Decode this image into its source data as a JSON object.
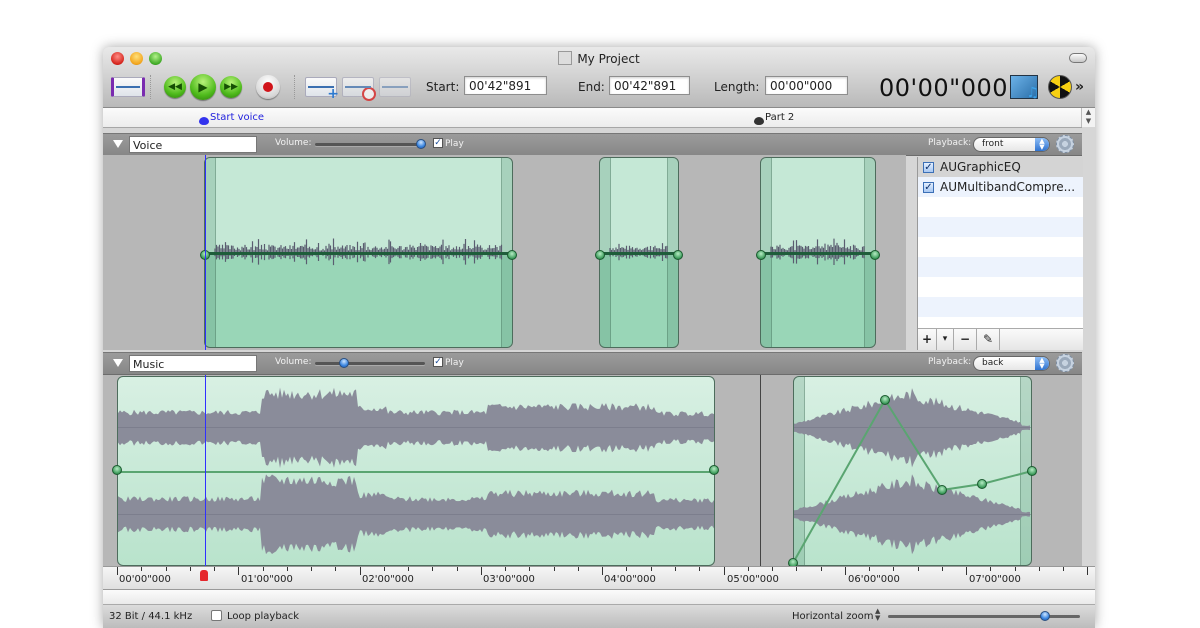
{
  "window": {
    "title": "My Project"
  },
  "toolbar": {
    "start_label": "Start:",
    "start_value": "00'42\"891",
    "end_label": "End:",
    "end_value": "00'42\"891",
    "length_label": "Length:",
    "length_value": "00'00\"000",
    "current_time": "00'00\"000",
    "overflow": "»"
  },
  "markers": [
    {
      "label": "Start voice",
      "color": "#2222dd"
    },
    {
      "label": "Part 2",
      "color": "#222222"
    }
  ],
  "tracks": [
    {
      "name": "Voice",
      "volume_label": "Volume:",
      "volume_fraction": 0.96,
      "play_label": "Play",
      "play_checked": true,
      "playback_label": "Playback:",
      "playback_value": "front",
      "effects": [
        {
          "name": "AUGraphicEQ",
          "enabled": true
        },
        {
          "name": "AUMultibandCompre...",
          "enabled": true
        }
      ],
      "effects_toolbar": {
        "add": "+",
        "menu": "▾",
        "remove": "−",
        "edit": "✎"
      }
    },
    {
      "name": "Music",
      "volume_label": "Volume:",
      "volume_fraction": 0.26,
      "play_label": "Play",
      "play_checked": true,
      "playback_label": "Playback:",
      "playback_value": "back"
    }
  ],
  "ruler": {
    "labels": [
      "00'00\"000",
      "01'00\"000",
      "02'00\"000",
      "03'00\"000",
      "04'00\"000",
      "05'00\"000",
      "06'00\"000",
      "07'00\"000"
    ]
  },
  "status": {
    "format": "32 Bit / 44.1 kHz",
    "loop_label": "Loop playback",
    "loop_checked": false,
    "zoom_label": "Horizontal zoom",
    "zoom_fraction": 0.82
  },
  "colors": {
    "clip_fill": "#c5e8d6",
    "clip_fill_dark": "#99d6b7",
    "waveform": "#8a8c9a",
    "envelope": "#3b9b5a",
    "playhead": "#3030ff",
    "accent_blue": "#3b86e0"
  }
}
